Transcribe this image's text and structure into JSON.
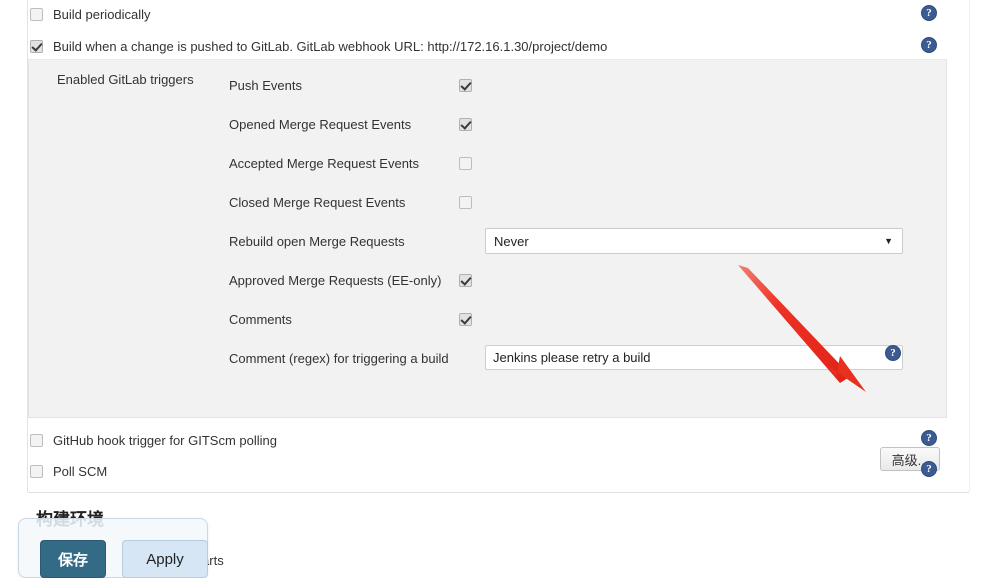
{
  "top_checkboxes": [
    {
      "label": "Build periodically",
      "checked": false,
      "help": "help-icon"
    },
    {
      "label": "Build when a change is pushed to GitLab. GitLab webhook URL: http://172.16.1.30/project/demo",
      "checked": true,
      "help": "help-icon"
    }
  ],
  "gitlab_panel": {
    "title": "Enabled GitLab triggers",
    "rows": [
      {
        "label": "Push Events",
        "type": "checkbox",
        "checked": true
      },
      {
        "label": "Opened Merge Request Events",
        "type": "checkbox",
        "checked": true
      },
      {
        "label": "Accepted Merge Request Events",
        "type": "checkbox",
        "checked": false
      },
      {
        "label": "Closed Merge Request Events",
        "type": "checkbox",
        "checked": false
      },
      {
        "label": "Rebuild open Merge Requests",
        "type": "select",
        "value": "Never"
      },
      {
        "label": "Approved Merge Requests (EE-only)",
        "type": "checkbox",
        "checked": true
      },
      {
        "label": "Comments",
        "type": "checkbox",
        "checked": true
      },
      {
        "label": "Comment (regex) for triggering a build",
        "type": "text",
        "value": "Jenkins please retry a build"
      }
    ],
    "advanced_button": "高级..."
  },
  "bottom_checkboxes": [
    {
      "label": "GitHub hook trigger for GITScm polling",
      "checked": false,
      "help": "help-icon"
    },
    {
      "label": "Poll SCM",
      "checked": false,
      "help": "help-icon"
    }
  ],
  "section": {
    "heading": "构建环境",
    "occluded_text": "e build starts"
  },
  "save_bar": {
    "save_label": "保存",
    "apply_label": "Apply"
  },
  "icons": {
    "help": "?",
    "select_caret": "▼"
  },
  "colors": {
    "panel_bg": "#f2f2f2",
    "help_icon": "#3b5b92",
    "save_button": "#336b87",
    "apply_button": "#d6e6f4",
    "annotation_arrow": "#ec3224"
  }
}
